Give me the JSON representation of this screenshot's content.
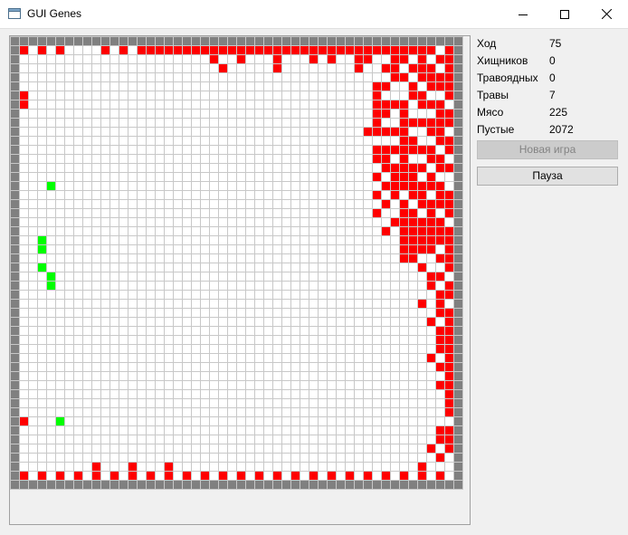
{
  "window": {
    "title": "GUI Genes",
    "controls": [
      "minimize-icon",
      "maximize-icon",
      "close-icon"
    ]
  },
  "stats": [
    {
      "label": "Ход",
      "value": "75"
    },
    {
      "label": "Хищников",
      "value": "0"
    },
    {
      "label": "Травоядных",
      "value": "0"
    },
    {
      "label": "Травы",
      "value": "7"
    },
    {
      "label": "Мясо",
      "value": "225"
    },
    {
      "label": "Пустые",
      "value": "2072"
    }
  ],
  "buttons": {
    "new_game": "Новая игра",
    "new_game_enabled": false,
    "pause": "Пауза"
  },
  "board": {
    "columns": 50,
    "rows": 50,
    "colors": {
      "wall": "#808080",
      "empty": "#ffffff",
      "meat": "#ff0000",
      "grass": "#00ff00",
      "gridline": "#c8c8c8"
    },
    "meat": [
      [
        1,
        1
      ],
      [
        3,
        1
      ],
      [
        5,
        1
      ],
      [
        10,
        1
      ],
      [
        12,
        1
      ],
      [
        14,
        1
      ],
      [
        15,
        1
      ],
      [
        16,
        1
      ],
      [
        17,
        1
      ],
      [
        18,
        1
      ],
      [
        19,
        1
      ],
      [
        20,
        1
      ],
      [
        21,
        1
      ],
      [
        22,
        1
      ],
      [
        23,
        1
      ],
      [
        24,
        1
      ],
      [
        25,
        1
      ],
      [
        26,
        1
      ],
      [
        27,
        1
      ],
      [
        28,
        1
      ],
      [
        29,
        1
      ],
      [
        30,
        1
      ],
      [
        31,
        1
      ],
      [
        32,
        1
      ],
      [
        33,
        1
      ],
      [
        34,
        1
      ],
      [
        35,
        1
      ],
      [
        36,
        1
      ],
      [
        37,
        1
      ],
      [
        38,
        1
      ],
      [
        39,
        1
      ],
      [
        40,
        1
      ],
      [
        41,
        1
      ],
      [
        42,
        1
      ],
      [
        43,
        1
      ],
      [
        44,
        1
      ],
      [
        45,
        1
      ],
      [
        46,
        1
      ],
      [
        48,
        1
      ],
      [
        22,
        2
      ],
      [
        25,
        2
      ],
      [
        29,
        2
      ],
      [
        33,
        2
      ],
      [
        35,
        2
      ],
      [
        38,
        2
      ],
      [
        39,
        2
      ],
      [
        42,
        2
      ],
      [
        43,
        2
      ],
      [
        45,
        2
      ],
      [
        47,
        2
      ],
      [
        48,
        2
      ],
      [
        23,
        3
      ],
      [
        29,
        3
      ],
      [
        38,
        3
      ],
      [
        41,
        3
      ],
      [
        42,
        3
      ],
      [
        44,
        3
      ],
      [
        45,
        3
      ],
      [
        46,
        3
      ],
      [
        48,
        3
      ],
      [
        42,
        4
      ],
      [
        43,
        4
      ],
      [
        45,
        4
      ],
      [
        46,
        4
      ],
      [
        47,
        4
      ],
      [
        48,
        4
      ],
      [
        40,
        5
      ],
      [
        41,
        5
      ],
      [
        44,
        5
      ],
      [
        46,
        5
      ],
      [
        47,
        5
      ],
      [
        48,
        5
      ],
      [
        1,
        6
      ],
      [
        40,
        6
      ],
      [
        44,
        6
      ],
      [
        45,
        6
      ],
      [
        48,
        6
      ],
      [
        1,
        7
      ],
      [
        40,
        7
      ],
      [
        41,
        7
      ],
      [
        42,
        7
      ],
      [
        43,
        7
      ],
      [
        45,
        7
      ],
      [
        46,
        7
      ],
      [
        47,
        7
      ],
      [
        40,
        8
      ],
      [
        41,
        8
      ],
      [
        43,
        8
      ],
      [
        47,
        8
      ],
      [
        48,
        8
      ],
      [
        40,
        9
      ],
      [
        43,
        9
      ],
      [
        44,
        9
      ],
      [
        45,
        9
      ],
      [
        46,
        9
      ],
      [
        47,
        9
      ],
      [
        48,
        9
      ],
      [
        39,
        10
      ],
      [
        40,
        10
      ],
      [
        41,
        10
      ],
      [
        42,
        10
      ],
      [
        43,
        10
      ],
      [
        46,
        10
      ],
      [
        47,
        10
      ],
      [
        43,
        11
      ],
      [
        44,
        11
      ],
      [
        47,
        11
      ],
      [
        48,
        11
      ],
      [
        40,
        12
      ],
      [
        41,
        12
      ],
      [
        42,
        12
      ],
      [
        43,
        12
      ],
      [
        44,
        12
      ],
      [
        45,
        12
      ],
      [
        46,
        12
      ],
      [
        48,
        12
      ],
      [
        40,
        13
      ],
      [
        41,
        13
      ],
      [
        43,
        13
      ],
      [
        46,
        13
      ],
      [
        47,
        13
      ],
      [
        41,
        14
      ],
      [
        42,
        14
      ],
      [
        43,
        14
      ],
      [
        44,
        14
      ],
      [
        45,
        14
      ],
      [
        47,
        14
      ],
      [
        48,
        14
      ],
      [
        40,
        15
      ],
      [
        42,
        15
      ],
      [
        43,
        15
      ],
      [
        44,
        15
      ],
      [
        46,
        15
      ],
      [
        41,
        16
      ],
      [
        42,
        16
      ],
      [
        43,
        16
      ],
      [
        44,
        16
      ],
      [
        45,
        16
      ],
      [
        46,
        16
      ],
      [
        47,
        16
      ],
      [
        40,
        17
      ],
      [
        42,
        17
      ],
      [
        44,
        17
      ],
      [
        45,
        17
      ],
      [
        47,
        17
      ],
      [
        48,
        17
      ],
      [
        41,
        18
      ],
      [
        43,
        18
      ],
      [
        45,
        18
      ],
      [
        46,
        18
      ],
      [
        47,
        18
      ],
      [
        48,
        18
      ],
      [
        40,
        19
      ],
      [
        43,
        19
      ],
      [
        44,
        19
      ],
      [
        46,
        19
      ],
      [
        48,
        19
      ],
      [
        42,
        20
      ],
      [
        43,
        20
      ],
      [
        44,
        20
      ],
      [
        45,
        20
      ],
      [
        46,
        20
      ],
      [
        47,
        20
      ],
      [
        41,
        21
      ],
      [
        43,
        21
      ],
      [
        44,
        21
      ],
      [
        45,
        21
      ],
      [
        46,
        21
      ],
      [
        47,
        21
      ],
      [
        48,
        21
      ],
      [
        43,
        22
      ],
      [
        44,
        22
      ],
      [
        45,
        22
      ],
      [
        46,
        22
      ],
      [
        47,
        22
      ],
      [
        48,
        22
      ],
      [
        43,
        23
      ],
      [
        44,
        23
      ],
      [
        45,
        23
      ],
      [
        46,
        23
      ],
      [
        48,
        23
      ],
      [
        43,
        24
      ],
      [
        44,
        24
      ],
      [
        47,
        24
      ],
      [
        48,
        24
      ],
      [
        45,
        25
      ],
      [
        48,
        25
      ],
      [
        46,
        26
      ],
      [
        47,
        26
      ],
      [
        46,
        27
      ],
      [
        48,
        27
      ],
      [
        47,
        28
      ],
      [
        48,
        28
      ],
      [
        45,
        29
      ],
      [
        47,
        29
      ],
      [
        47,
        30
      ],
      [
        48,
        30
      ],
      [
        46,
        31
      ],
      [
        48,
        31
      ],
      [
        47,
        32
      ],
      [
        48,
        32
      ],
      [
        47,
        33
      ],
      [
        48,
        33
      ],
      [
        47,
        34
      ],
      [
        48,
        34
      ],
      [
        46,
        35
      ],
      [
        48,
        35
      ],
      [
        47,
        36
      ],
      [
        48,
        36
      ],
      [
        48,
        37
      ],
      [
        47,
        38
      ],
      [
        48,
        38
      ],
      [
        48,
        39
      ],
      [
        48,
        40
      ],
      [
        48,
        41
      ],
      [
        1,
        42
      ],
      [
        47,
        43
      ],
      [
        48,
        43
      ],
      [
        47,
        44
      ],
      [
        48,
        44
      ],
      [
        46,
        45
      ],
      [
        48,
        45
      ],
      [
        47,
        46
      ],
      [
        9,
        47
      ],
      [
        13,
        47
      ],
      [
        17,
        47
      ],
      [
        45,
        47
      ],
      [
        1,
        48
      ],
      [
        3,
        48
      ],
      [
        5,
        48
      ],
      [
        7,
        48
      ],
      [
        9,
        48
      ],
      [
        11,
        48
      ],
      [
        13,
        48
      ],
      [
        15,
        48
      ],
      [
        17,
        48
      ],
      [
        19,
        48
      ],
      [
        21,
        48
      ],
      [
        23,
        48
      ],
      [
        25,
        48
      ],
      [
        27,
        48
      ],
      [
        29,
        48
      ],
      [
        31,
        48
      ],
      [
        33,
        48
      ],
      [
        35,
        48
      ],
      [
        37,
        48
      ],
      [
        39,
        48
      ],
      [
        41,
        48
      ],
      [
        43,
        48
      ],
      [
        45,
        48
      ],
      [
        47,
        48
      ]
    ],
    "grass": [
      [
        4,
        16
      ],
      [
        3,
        22
      ],
      [
        3,
        23
      ],
      [
        3,
        25
      ],
      [
        4,
        26
      ],
      [
        4,
        27
      ],
      [
        5,
        42
      ]
    ]
  }
}
